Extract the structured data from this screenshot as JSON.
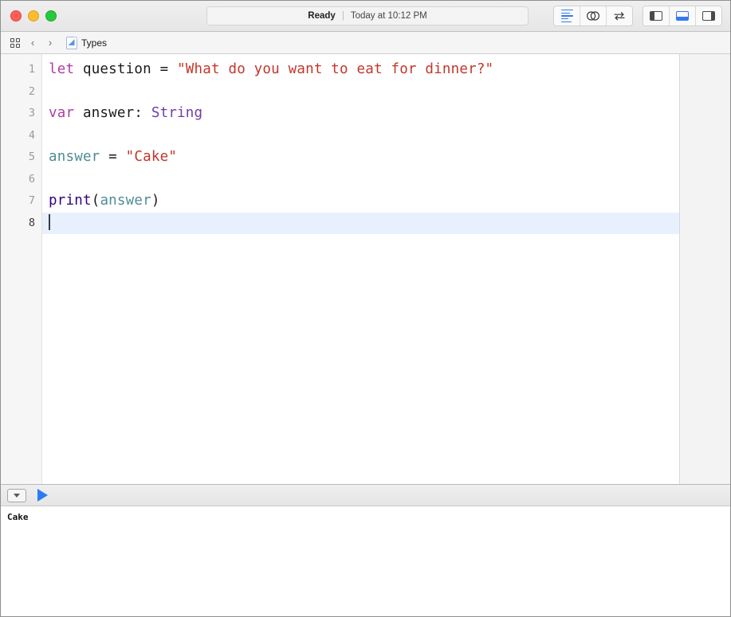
{
  "window": {
    "traffic_lights": [
      {
        "name": "close",
        "color": "#ff5f57"
      },
      {
        "name": "minimize",
        "color": "#febc2e"
      },
      {
        "name": "maximize",
        "color": "#28c840"
      }
    ]
  },
  "titlebar": {
    "status_ready": "Ready",
    "status_separator": "|",
    "status_time": "Today at 10:12 PM",
    "editor_buttons": [
      {
        "name": "standard-editor",
        "icon": "lines-icon",
        "active": true
      },
      {
        "name": "assistant-editor",
        "icon": "venn-circles-icon",
        "active": false
      },
      {
        "name": "version-editor",
        "icon": "swap-arrows-icon",
        "active": false
      }
    ],
    "panel_buttons": [
      {
        "name": "toggle-navigator",
        "icon": "panel-left-icon",
        "active": false
      },
      {
        "name": "toggle-debug-area",
        "icon": "panel-bottom-icon",
        "active": true
      },
      {
        "name": "toggle-inspector",
        "icon": "panel-right-icon",
        "active": false
      }
    ]
  },
  "jumpbar": {
    "grid_icon": "grid-icon",
    "back_chevron": "‹",
    "forward_chevron": "›",
    "file_icon": "playground-file-icon",
    "crumb": "Types"
  },
  "editor": {
    "line_numbers": [
      "1",
      "2",
      "3",
      "4",
      "5",
      "6",
      "7",
      "8"
    ],
    "active_line": 8,
    "lines": [
      {
        "number": "1",
        "tokens": [
          {
            "t": "let",
            "c": "key"
          },
          {
            "t": " question = ",
            "c": "plain"
          },
          {
            "t": "\"What do you want to eat for dinner?\"",
            "c": "str"
          }
        ]
      },
      {
        "number": "2",
        "tokens": []
      },
      {
        "number": "3",
        "tokens": [
          {
            "t": "var",
            "c": "key"
          },
          {
            "t": " answer: ",
            "c": "plain"
          },
          {
            "t": "String",
            "c": "type"
          }
        ]
      },
      {
        "number": "4",
        "tokens": []
      },
      {
        "number": "5",
        "tokens": [
          {
            "t": "answer",
            "c": "var"
          },
          {
            "t": " = ",
            "c": "plain"
          },
          {
            "t": "\"Cake\"",
            "c": "str"
          }
        ]
      },
      {
        "number": "6",
        "tokens": []
      },
      {
        "number": "7",
        "tokens": [
          {
            "t": "print",
            "c": "fn"
          },
          {
            "t": "(",
            "c": "plain"
          },
          {
            "t": "answer",
            "c": "var"
          },
          {
            "t": ")",
            "c": "plain"
          }
        ]
      },
      {
        "number": "8",
        "tokens": []
      }
    ],
    "colors": {
      "keyword": "#ad3da4",
      "string": "#c4352b",
      "type": "#703daa",
      "variable": "#4e8c96",
      "function": "#31007e",
      "plain": "#1c1c1c",
      "active_line_bg": "#e8f0fd"
    }
  },
  "console": {
    "disclosure_icon": "disclosure-triangle-icon",
    "run_icon": "play-icon",
    "output": "Cake"
  }
}
